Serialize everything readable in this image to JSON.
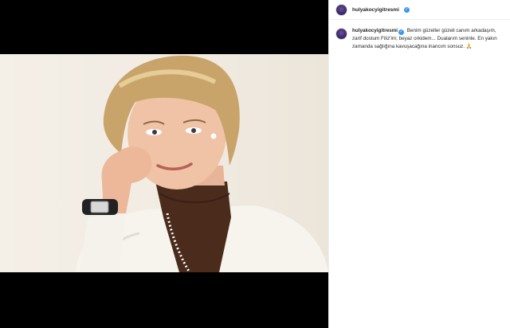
{
  "post": {
    "username": "hulyakocyigitresmi",
    "caption": "Benim güzeller güzeli canım arkadaşım, zarif dostum Filiz'im; beyaz orkidem... Dualarım seninle. En yakın zamanda sağlığına kavuşacağına inancım sonsuz. 🙏",
    "verified_icon": "verified-badge-icon",
    "accent": "#3897f0"
  }
}
